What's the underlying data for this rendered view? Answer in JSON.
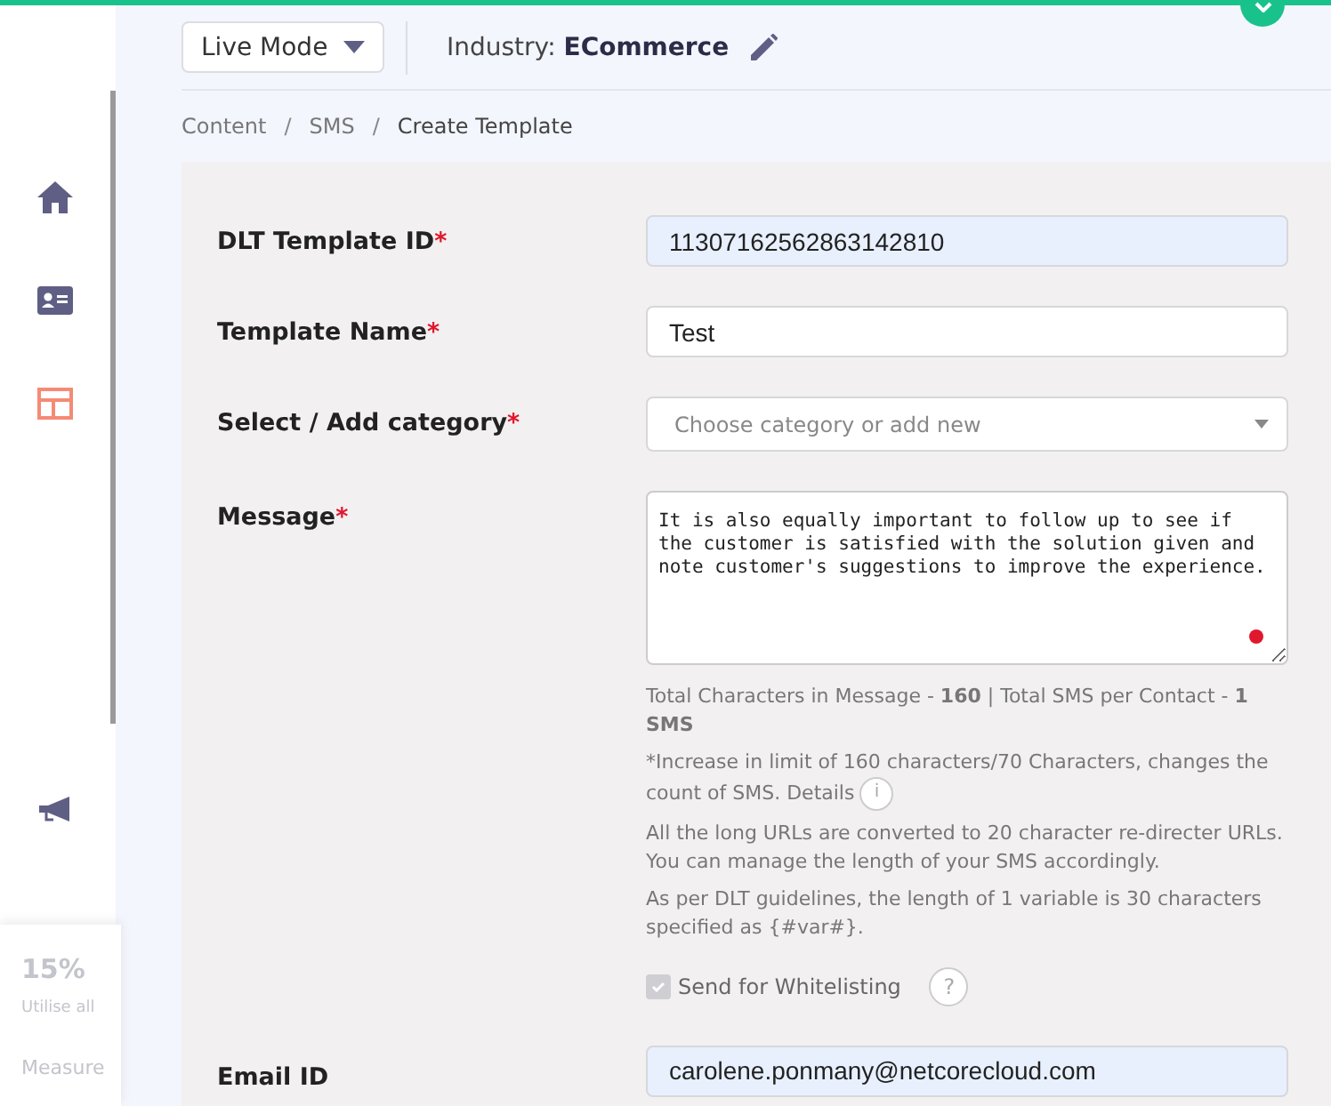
{
  "sidebar": {
    "items": [
      {
        "kind": "home",
        "selected": false
      },
      {
        "kind": "contact",
        "selected": false
      },
      {
        "kind": "layout",
        "selected": true
      },
      {
        "kind": "megaphone",
        "selected": false
      }
    ]
  },
  "promo_card": {
    "title": "15%",
    "text": "Utilise all",
    "footer": "Measure"
  },
  "top_bar": {
    "mode": "Live Mode",
    "industry_label": "Industry:",
    "industry_value": "ECommerce"
  },
  "breadcrumb": [
    {
      "label": "Content",
      "current": false
    },
    {
      "separator": "/",
      "label": "SMS",
      "current": false
    },
    {
      "separator": "/",
      "label": "Create Template",
      "current": true
    }
  ],
  "form": [
    {
      "kind": "input",
      "label": "DLT Template ID",
      "required_mark": "*",
      "value": "11307162562863142810",
      "autofilled": true
    },
    {
      "kind": "input",
      "label": "Template Name",
      "required_mark": "*",
      "value": "Test",
      "autofilled": false
    },
    {
      "kind": "select",
      "label": "Select / Add category",
      "required_mark": "*",
      "placeholder": "Choose category or add new"
    },
    {
      "kind": "textarea",
      "label": "Message",
      "required_mark": "*",
      "value": "It is also equally important to follow up to see if the customer is satisfied with the solution given and note customer's suggestions to improve the experience."
    }
  ],
  "message_info": {
    "counts": "Total Characters in Message - **160** | Total SMS per Contact - **1 SMS**",
    "notes": [
      "*Increase in limit of 160 characters/70 Characters, changes the count of SMS. Details",
      "All the long URLs are converted to 20 character re-directer URLs. You can manage the length of your SMS accordingly.",
      "As per DLT guidelines, the length of 1 variable is 30 characters specified as {#var#}."
    ],
    "details_icon": "i"
  },
  "whitelisting": {
    "label": "Send for Whitelisting",
    "checked": true,
    "disabled": true,
    "help": "?"
  },
  "email": {
    "label": "Email ID",
    "value": "carolene.ponmany@netcorecloud.com",
    "autofilled": true
  }
}
